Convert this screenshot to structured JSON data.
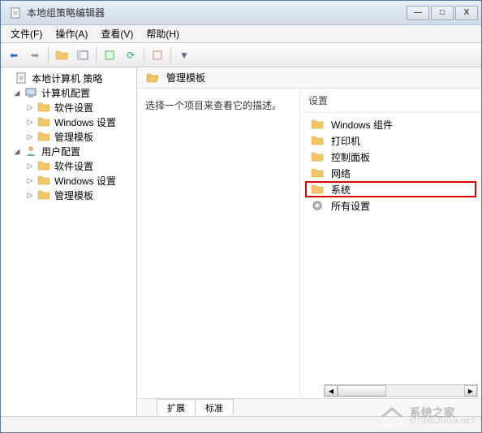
{
  "window": {
    "title": "本地组策略编辑器",
    "controls": {
      "min": "—",
      "max": "□",
      "close": "X"
    }
  },
  "menu": {
    "items": [
      {
        "label": "文件(F)"
      },
      {
        "label": "操作(A)"
      },
      {
        "label": "查看(V)"
      },
      {
        "label": "帮助(H)"
      }
    ]
  },
  "tree": {
    "root": {
      "label": "本地计算机 策略",
      "children": [
        {
          "label": "计算机配置",
          "expanded": true,
          "children": [
            {
              "label": "软件设置"
            },
            {
              "label": "Windows 设置"
            },
            {
              "label": "管理模板"
            }
          ]
        },
        {
          "label": "用户配置",
          "expanded": true,
          "children": [
            {
              "label": "软件设置"
            },
            {
              "label": "Windows 设置"
            },
            {
              "label": "管理模板"
            }
          ]
        }
      ]
    }
  },
  "main": {
    "header_title": "管理模板",
    "description_prompt": "选择一个项目来查看它的描述。",
    "settings_header": "设置",
    "settings": [
      {
        "label": "Windows 组件",
        "icon": "folder",
        "highlighted": false
      },
      {
        "label": "打印机",
        "icon": "folder",
        "highlighted": false
      },
      {
        "label": "控制面板",
        "icon": "folder",
        "highlighted": false
      },
      {
        "label": "网络",
        "icon": "folder",
        "highlighted": false
      },
      {
        "label": "系统",
        "icon": "folder",
        "highlighted": true
      },
      {
        "label": "所有设置",
        "icon": "settings",
        "highlighted": false
      }
    ],
    "tabs": [
      {
        "label": "扩展"
      },
      {
        "label": "标准"
      }
    ]
  },
  "watermark": {
    "line1": "系统之家",
    "line2": "XITONGZHIJIA.NET"
  }
}
